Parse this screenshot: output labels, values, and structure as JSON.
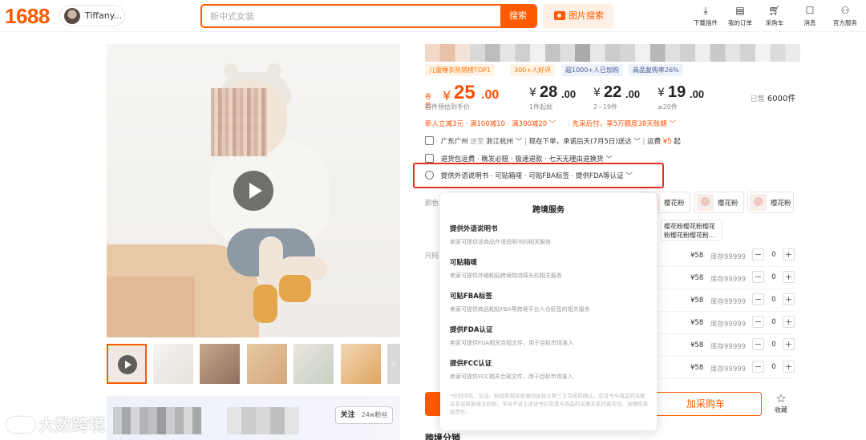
{
  "header": {
    "logo": "1688",
    "user_name": "Tiffany...",
    "search_placeholder": "新中式女装",
    "search_button": "搜索",
    "image_search": "图片搜索",
    "nav": [
      {
        "label": "下载插件",
        "icon": "download-icon"
      },
      {
        "label": "我的订单",
        "icon": "order-icon"
      },
      {
        "label": "采购车",
        "icon": "cart-icon"
      },
      {
        "label": "消息",
        "icon": "message-icon"
      },
      {
        "label": "官方服务",
        "icon": "user-icon"
      }
    ]
  },
  "gallery": {
    "thumbnail_count": 6
  },
  "store": {
    "follow_label": "关注",
    "fans": "24w粉丝"
  },
  "product": {
    "tags": [
      "儿童睡衣热销榜TOP1",
      "300+人好评",
      "超1000+人已加购",
      "商品复购率26%"
    ],
    "price_main": {
      "prefix": "券后",
      "yen": "¥",
      "integer": "25",
      "decimal": ".00",
      "sub": "首件预估到手价"
    },
    "tiers": [
      {
        "yen": "¥",
        "integer": "28",
        "decimal": ".00",
        "sub": "1件起批"
      },
      {
        "yen": "¥",
        "integer": "22",
        "decimal": ".00",
        "sub": "2~19件"
      },
      {
        "yen": "¥",
        "integer": "19",
        "decimal": ".00",
        "sub": "≥20件"
      }
    ],
    "sold_prefix": "已售",
    "sold_count": "6000件",
    "promo_left": "新人立减3元 · 满100减10 · 满300减20 ﹀",
    "promo_right": "先采后付，享5万额度38天账期 ﹀",
    "shipping_from": "广东广州",
    "shipping_to_label": "送至",
    "shipping_to": "浙江杭州 ﹀",
    "delivery": "现在下单，承诺后天(7月5日)送达 ﹀",
    "freight_label": "运费",
    "freight": "¥5",
    "freight_suffix": "起",
    "guarantee": "退货包运费 · 晚发必赔 · 极速退款 · 七天无理由退换货 ﹀",
    "crossborder": "提供外语说明书 · 可贴箱唛 · 可贴FBA标签 · 提供FDA等认证 ﹀",
    "color_label": "颜色",
    "size_label": "尺码",
    "swatches": [
      "樱花粉",
      "樱花粉",
      "樱花粉"
    ],
    "swatch_long": "樱花粉樱花粉樱花粉樱花粉樱花粉...",
    "sku_rows": [
      {
        "price": "¥58",
        "stock": "库存99999",
        "qty": "0"
      },
      {
        "price": "¥58",
        "stock": "库存99999",
        "qty": "0"
      },
      {
        "price": "¥58",
        "stock": "库存99999",
        "qty": "0"
      },
      {
        "price": "¥58",
        "stock": "库存99999",
        "qty": "0"
      },
      {
        "price": "¥58",
        "stock": "库存99999",
        "qty": "0"
      },
      {
        "price": "¥58",
        "stock": "库存99999",
        "qty": "0"
      }
    ],
    "add_cart": "加采购车",
    "favorite": "收藏",
    "bottom_section": "跨境分销"
  },
  "popup": {
    "title": "跨境服务",
    "items": [
      {
        "title": "提供外语说明书",
        "desc": "卖家可提供该商品外语说明书的相关服务"
      },
      {
        "title": "可贴箱唛",
        "desc": "卖家可提供外箱粘贴跨境物流唛头的相关服务"
      },
      {
        "title": "可贴FBA标签",
        "desc": "卖家可提供商品粘贴FBA等跨境平台入仓标签的相关服务"
      },
      {
        "title": "提供FDA认证",
        "desc": "卖家可提供FDA相关合规文件，用于目标市场准入"
      },
      {
        "title": "提供FCC认证",
        "desc": "卖家可提供FCC相关合规文件，用于目标市场准入"
      }
    ],
    "note": "*任何评估、认证、检验和相关检查均由独立第三方完成和确认，且证书与商品的关联关系由商家自主匹配，平台不对上述证书以及其与商品的关联关系的真实性、准确性承担责任。"
  },
  "watermark": "大数跨境",
  "colors": {
    "accent": "#ff5a00",
    "highlight": "#e0301e"
  }
}
